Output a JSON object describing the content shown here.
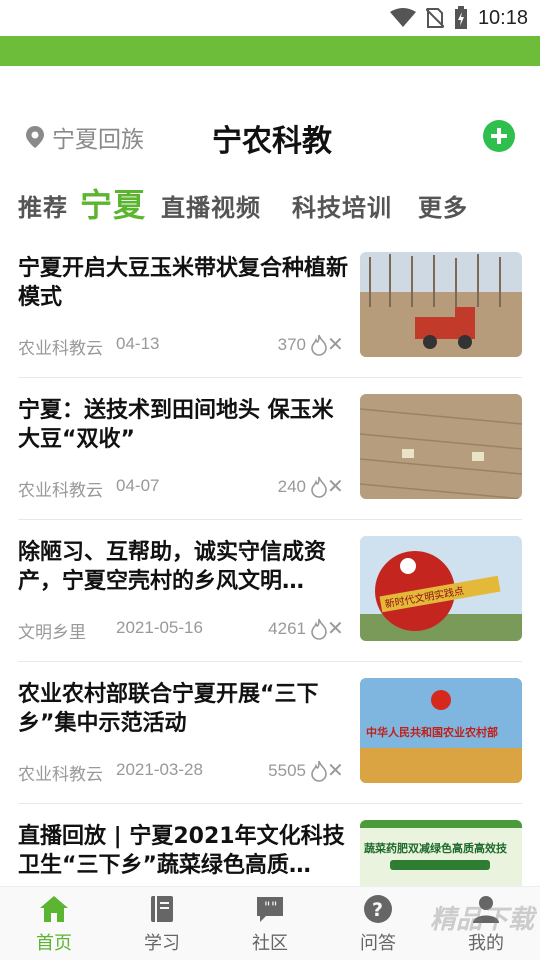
{
  "status_bar": {
    "time": "10:18"
  },
  "header": {
    "location": "宁夏回族",
    "title": "宁农科教"
  },
  "tabs": [
    {
      "label": "推荐",
      "active": false
    },
    {
      "label": "宁夏",
      "active": true
    },
    {
      "label": "直播视频",
      "active": false
    },
    {
      "label": "科技培训",
      "active": false
    },
    {
      "label": "更多",
      "active": false
    }
  ],
  "feed": [
    {
      "title": "宁夏开启大豆玉米带状复合种植新模式",
      "source": "农业科教云",
      "date": "04-13",
      "views": "370"
    },
    {
      "title": "宁夏：送技术到田间地头 保玉米大豆“双收”",
      "source": "农业科教云",
      "date": "04-07",
      "views": "240"
    },
    {
      "title": "除陋习、互帮助，诚实守信成资产，宁夏空壳村的乡风文明…",
      "source": "文明乡里",
      "date": "2021-05-16",
      "views": "4261",
      "thumb_text": "新时代文明实践点"
    },
    {
      "title": "农业农村部联合宁夏开展“三下乡”集中示范活动",
      "source": "农业科教云",
      "date": "2021-03-28",
      "views": "5505",
      "thumb_text": "中华人民共和国农业农村部"
    },
    {
      "title": "直播回放 | 宁夏2021年文化科技卫生“三下乡”蔬菜绿色高质…",
      "source": "",
      "date": "",
      "views": "",
      "thumb_text": "蔬菜药肥双减绿色高质高效技"
    }
  ],
  "bottom_nav": [
    {
      "label": "首页",
      "icon": "home-icon",
      "active": true
    },
    {
      "label": "学习",
      "icon": "book-icon",
      "active": false
    },
    {
      "label": "社区",
      "icon": "chat-icon",
      "active": false
    },
    {
      "label": "问答",
      "icon": "question-icon",
      "active": false
    },
    {
      "label": "我的",
      "icon": "user-icon",
      "active": false
    }
  ],
  "watermark": "精品下载",
  "colors": {
    "brand_green": "#6dbd3a",
    "add_button": "#2fbf4f",
    "active_tab": "#5cb531"
  }
}
